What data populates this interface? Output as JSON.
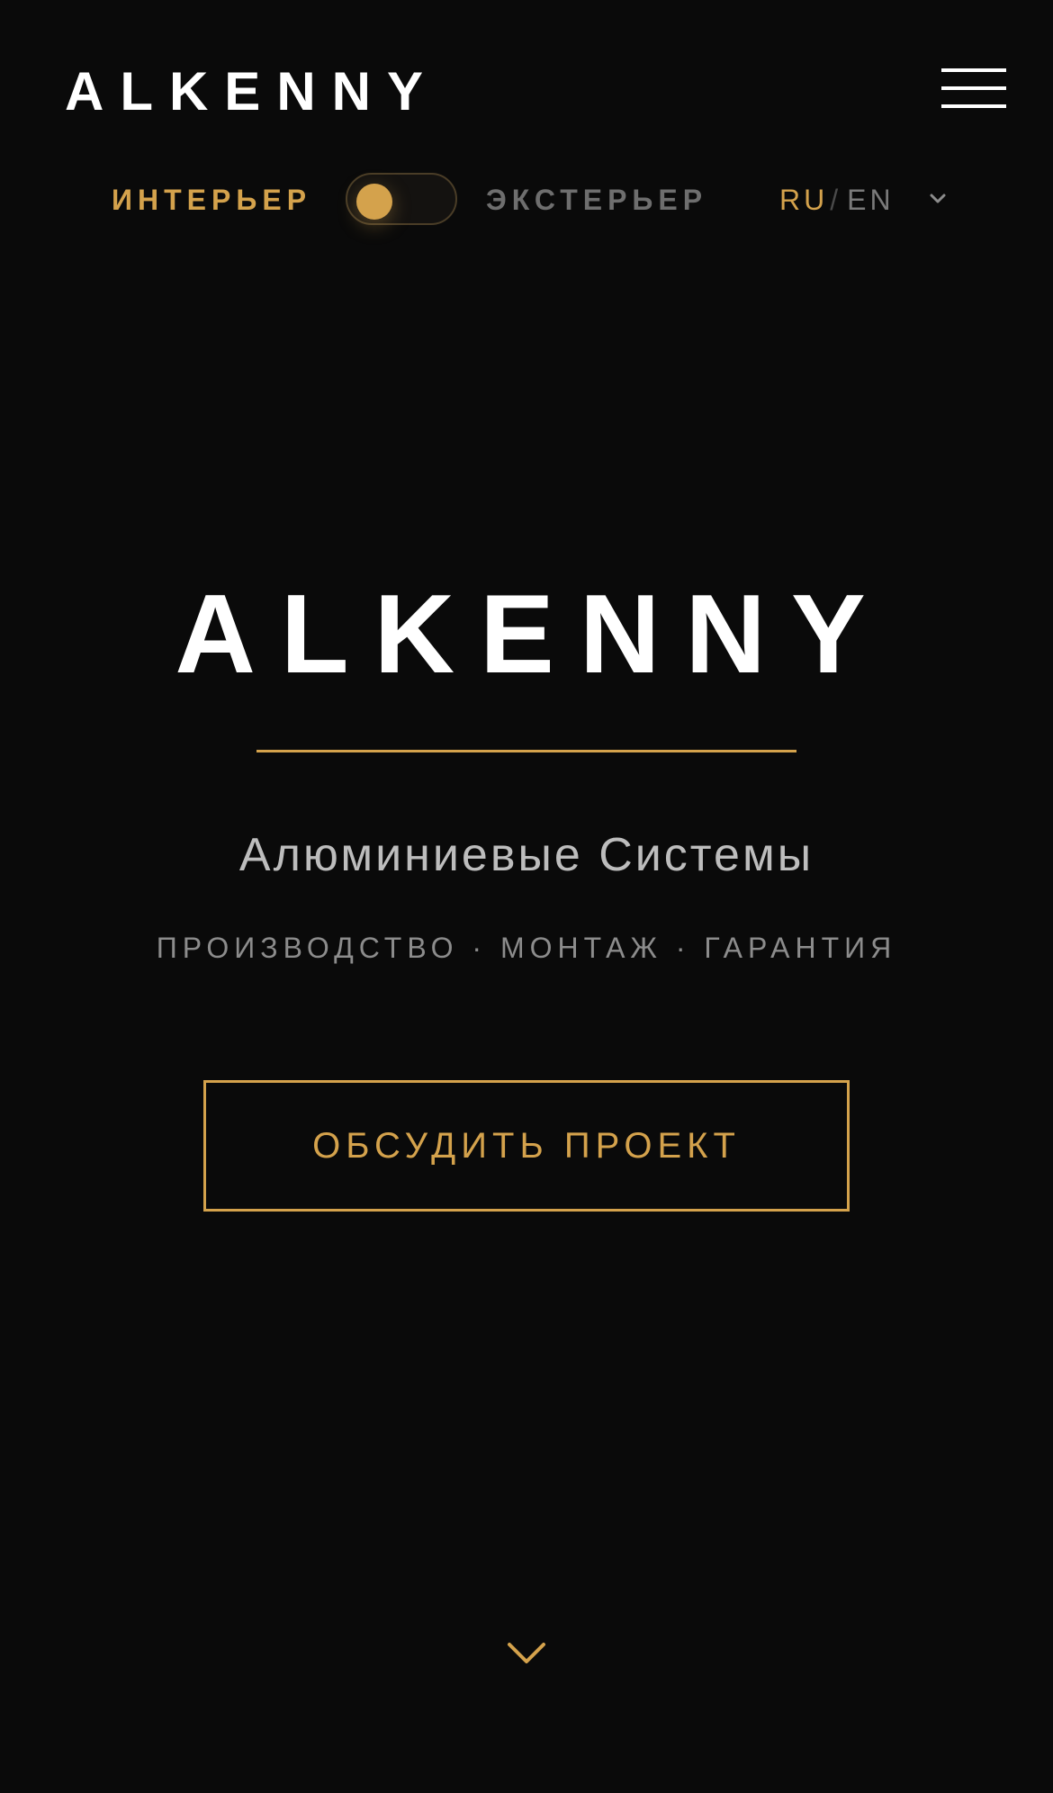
{
  "header": {
    "logo_text": "ALKENNY",
    "menu_icon": "hamburger-menu-icon"
  },
  "mode_switch": {
    "interior_label": "ИНТЕРЬЕР",
    "exterior_label": "ЭКСТЕРЬЕР",
    "selected": "interior"
  },
  "language": {
    "current": "RU",
    "separator": "/",
    "alternate": "EN",
    "icon": "chevron-down-icon"
  },
  "hero": {
    "title": "ALKENNY",
    "subtitle": "Алюминиевые Системы",
    "services": "ПРОИЗВОДСТВО · МОНТАЖ · ГАРАНТИЯ",
    "cta_label": "ОБСУДИТЬ ПРОЕКТ",
    "scroll_icon": "chevron-down-icon"
  },
  "colors": {
    "background": "#0a0a0a",
    "accent": "#d4a24c",
    "text_primary": "#ffffff",
    "text_muted": "#8c8c8c"
  }
}
